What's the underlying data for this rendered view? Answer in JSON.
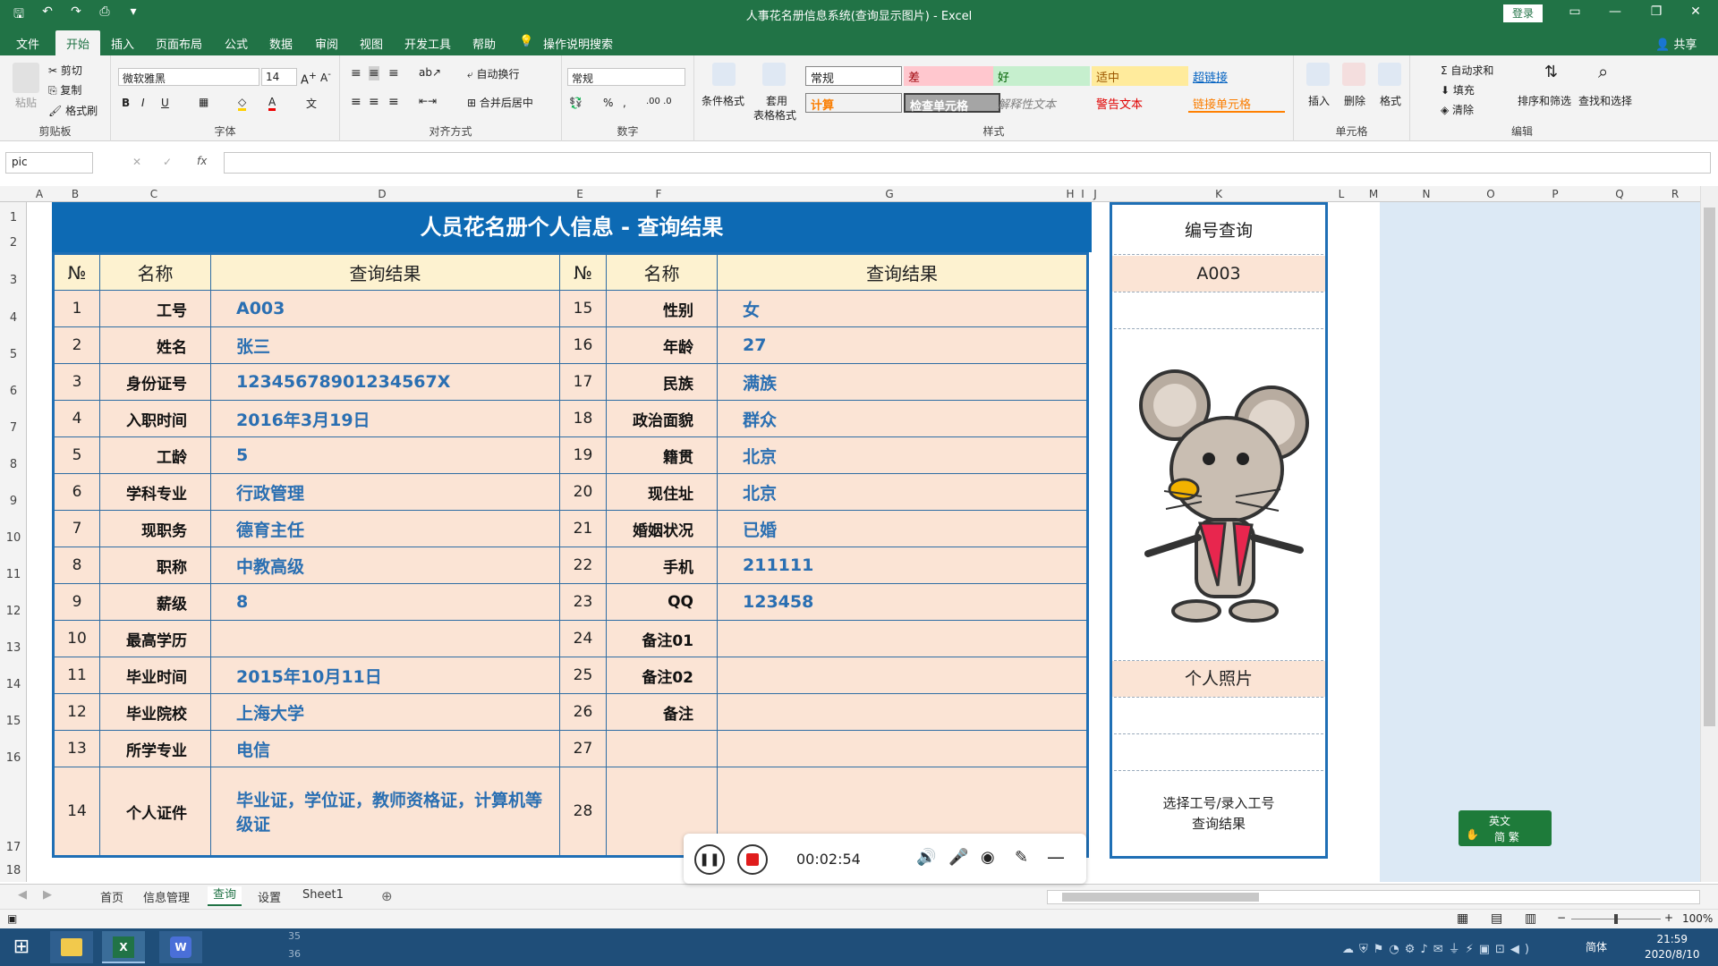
{
  "window": {
    "title": "人事花名册信息系统(查询显示图片) - Excel",
    "login": "登录"
  },
  "tabs": [
    {
      "label": "文件"
    },
    {
      "label": "开始"
    },
    {
      "label": "插入"
    },
    {
      "label": "页面布局"
    },
    {
      "label": "公式"
    },
    {
      "label": "数据"
    },
    {
      "label": "审阅"
    },
    {
      "label": "视图"
    },
    {
      "label": "开发工具"
    },
    {
      "label": "帮助"
    },
    {
      "label": "操作说明搜索"
    }
  ],
  "share": "共享",
  "ribbon": {
    "clipboard": {
      "paste": "粘贴",
      "cut": "剪切",
      "copy": "复制",
      "painter": "格式刷",
      "label": "剪贴板"
    },
    "font": {
      "name": "微软雅黑",
      "size": "14",
      "bold": "B",
      "italic": "I",
      "underline": "U",
      "label": "字体"
    },
    "align": {
      "wrap": "自动换行",
      "merge": "合并后居中",
      "label": "对齐方式"
    },
    "number": {
      "format": "常规",
      "label": "数字"
    },
    "styles": {
      "cond": "条件格式",
      "table": "套用",
      "table2": "表格格式",
      "cells": [
        "常规",
        "差",
        "好",
        "适中",
        "超链接",
        "计算",
        "检查单元格",
        "解释性文本",
        "警告文本",
        "链接单元格"
      ],
      "label": "样式"
    },
    "cells": {
      "insert": "插入",
      "delete": "删除",
      "format": "格式",
      "label": "单元格"
    },
    "edit": {
      "autosum": "自动求和",
      "fill": "填充",
      "clear": "清除",
      "sort": "排序和筛选",
      "find": "查找和选择",
      "label": "编辑"
    }
  },
  "formula_bar": {
    "namebox": "pic",
    "fx": "fx",
    "value": ""
  },
  "columns": [
    "A",
    "B",
    "C",
    "D",
    "E",
    "F",
    "G",
    "H",
    "I",
    "J",
    "K",
    "L",
    "M",
    "N",
    "O",
    "P",
    "Q",
    "R"
  ],
  "rows": [
    "1",
    "2",
    "3",
    "4",
    "5",
    "6",
    "7",
    "8",
    "9",
    "10",
    "11",
    "12",
    "13",
    "14",
    "15",
    "16",
    "17",
    "18"
  ],
  "sheet": {
    "banner": "人员花名册个人信息 - 查询结果",
    "headers": {
      "no": "№",
      "name": "名称",
      "result": "查询结果"
    },
    "rows": [
      {
        "n1": "1",
        "l1": "工号",
        "v1": "A003",
        "n2": "15",
        "l2": "性别",
        "v2": "女"
      },
      {
        "n1": "2",
        "l1": "姓名",
        "v1": "张三",
        "n2": "16",
        "l2": "年龄",
        "v2": "27"
      },
      {
        "n1": "3",
        "l1": "身份证号",
        "v1": "12345678901234567X",
        "n2": "17",
        "l2": "民族",
        "v2": "满族"
      },
      {
        "n1": "4",
        "l1": "入职时间",
        "v1": "2016年3月19日",
        "n2": "18",
        "l2": "政治面貌",
        "v2": "群众"
      },
      {
        "n1": "5",
        "l1": "工龄",
        "v1": "5",
        "n2": "19",
        "l2": "籍贯",
        "v2": "北京"
      },
      {
        "n1": "6",
        "l1": "学科专业",
        "v1": "行政管理",
        "n2": "20",
        "l2": "现住址",
        "v2": "北京"
      },
      {
        "n1": "7",
        "l1": "现职务",
        "v1": "德育主任",
        "n2": "21",
        "l2": "婚姻状况",
        "v2": "已婚"
      },
      {
        "n1": "8",
        "l1": "职称",
        "v1": "中教高级",
        "n2": "22",
        "l2": "手机",
        "v2": "211111"
      },
      {
        "n1": "9",
        "l1": "薪级",
        "v1": "8",
        "n2": "23",
        "l2": "QQ",
        "v2": "123458"
      },
      {
        "n1": "10",
        "l1": "最高学历",
        "v1": "",
        "n2": "24",
        "l2": "备注01",
        "v2": ""
      },
      {
        "n1": "11",
        "l1": "毕业时间",
        "v1": "2015年10月11日",
        "n2": "25",
        "l2": "备注02",
        "v2": ""
      },
      {
        "n1": "12",
        "l1": "毕业院校",
        "v1": "上海大学",
        "n2": "26",
        "l2": "备注",
        "v2": ""
      },
      {
        "n1": "13",
        "l1": "所学专业",
        "v1": "电信",
        "n2": "27",
        "l2": "",
        "v2": ""
      },
      {
        "n1": "14",
        "l1": "个人证件",
        "v1": "毕业证，学位证，教师资格证，计算机等级证",
        "n2": "28",
        "l2": "",
        "v2": ""
      }
    ],
    "lookup": {
      "title": "编号查询",
      "value": "A003",
      "photo_label": "个人照片",
      "hint1": "选择工号/录入工号",
      "hint2": "查询结果"
    }
  },
  "recorder": {
    "time": "00:02:54"
  },
  "ime": {
    "lang": "英文",
    "mode": "简 繁"
  },
  "sheet_tabs": [
    "首页",
    "信息管理",
    "查询",
    "设置",
    "Sheet1"
  ],
  "active_sheet": "查询",
  "status": {
    "zoom": "100%"
  },
  "taskbar": {
    "time": "21:59",
    "date": "2020/8/10",
    "ime": "简体",
    "rows_peek": [
      "35",
      "36"
    ]
  },
  "colors": {
    "excel_green": "#217346",
    "banner_blue": "#0d6ab4",
    "cell_peach": "#fbe4d5",
    "header_cream": "#fdf2d0",
    "value_blue": "#2a6fb2"
  }
}
